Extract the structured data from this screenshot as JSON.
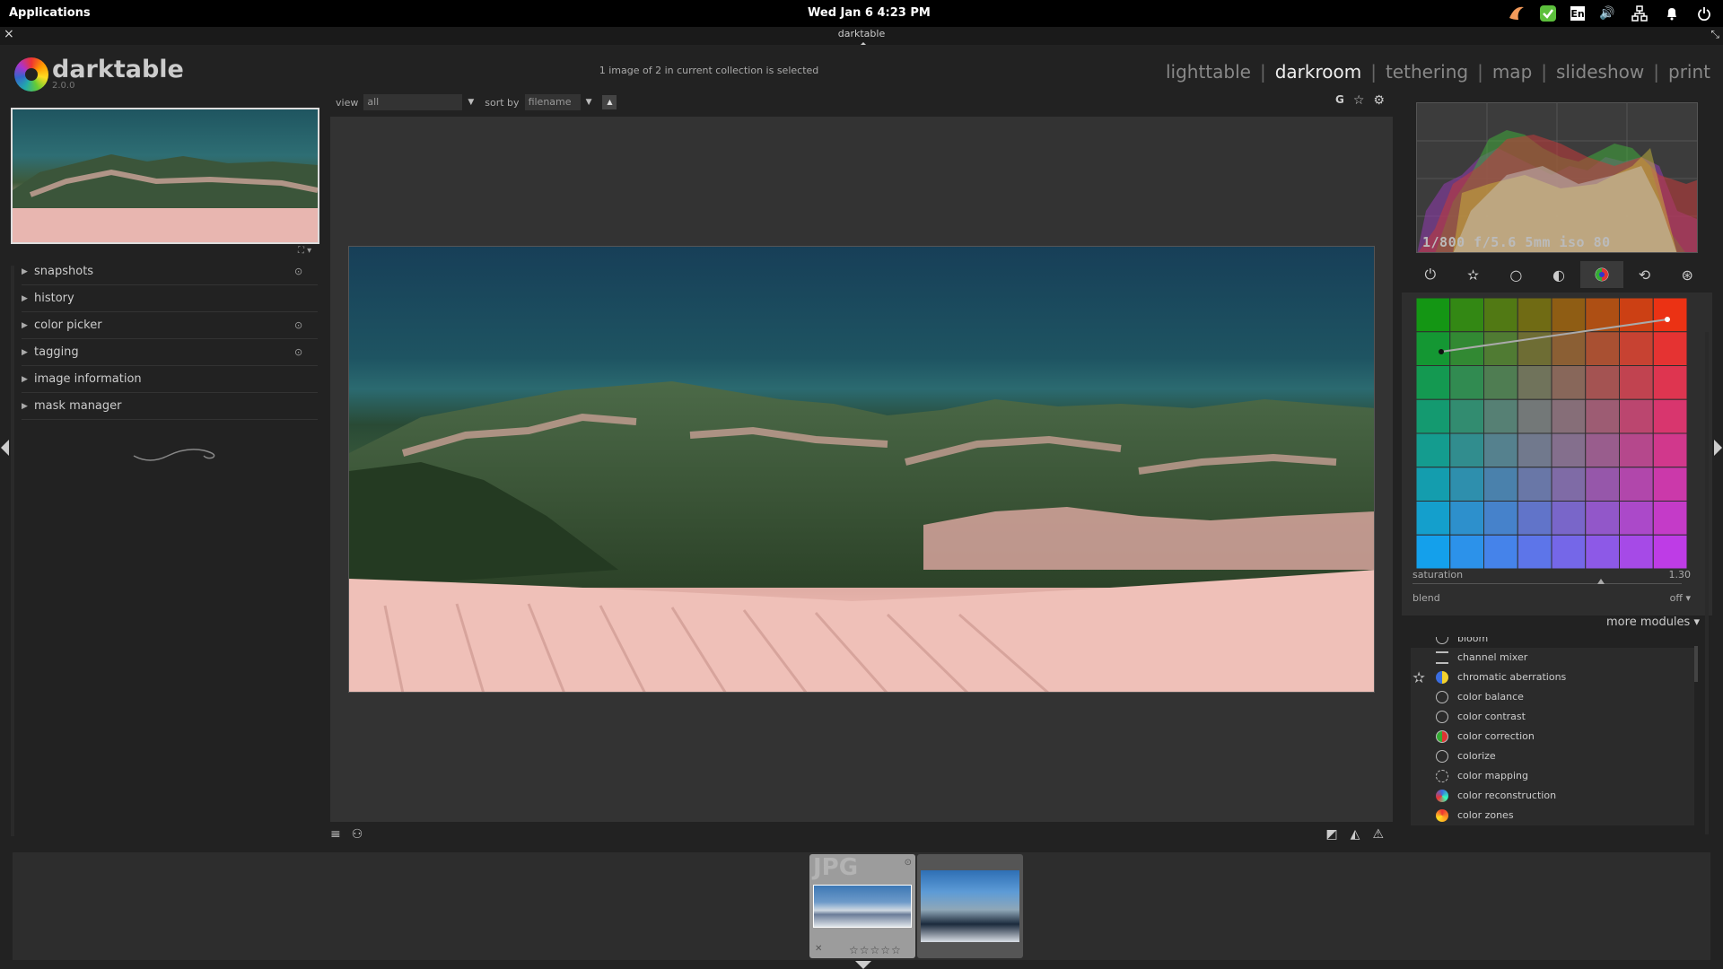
{
  "system_bar": {
    "applications": "Applications",
    "clock": "Wed Jan  6    4:23 PM",
    "tray_icons": [
      "night-light-icon",
      "shield-check-icon",
      "keyboard-layout-icon",
      "volume-icon",
      "network-icon",
      "notification-bell-icon",
      "power-icon"
    ],
    "keyboard_layout": "En"
  },
  "window": {
    "title": "darktable"
  },
  "app": {
    "name": "darktable",
    "version": "2.0.0"
  },
  "header": {
    "collection_info": "1 image of 2 in current collection is selected",
    "views": [
      "lighttable",
      "darkroom",
      "tethering",
      "map",
      "slideshow",
      "print"
    ],
    "active_view": "darkroom",
    "separator": "|"
  },
  "filter_bar": {
    "view_label": "view",
    "view_value": "all",
    "sort_label": "sort by",
    "sort_value": "filename"
  },
  "top_right_icons": {
    "grouping": "G"
  },
  "left_modules": [
    {
      "label": "snapshots",
      "pin": true
    },
    {
      "label": "history",
      "pin": false
    },
    {
      "label": "color picker",
      "pin": true
    },
    {
      "label": "tagging",
      "pin": true
    },
    {
      "label": "image information",
      "pin": false
    },
    {
      "label": "mask manager",
      "pin": false
    }
  ],
  "histogram": {
    "exif": "1/800 f/5.6 5mm iso 80"
  },
  "module_groups": [
    "power-icon",
    "favorite-star-icon",
    "basic-circle-icon",
    "tone-half-circle-icon",
    "color-icon",
    "correct-icon",
    "effect-icon"
  ],
  "color_correction": {
    "saturation_label": "saturation",
    "saturation_value": "1.30",
    "blend_label": "blend",
    "blend_value": "off"
  },
  "more_modules": {
    "label": "more modules"
  },
  "module_list": [
    {
      "label": "bloom",
      "icon": "bloom-icon"
    },
    {
      "label": "channel mixer",
      "icon": "channel-mixer-icon"
    },
    {
      "label": "chromatic aberrations",
      "icon": "chromatic-aberrations-icon",
      "favorite": true
    },
    {
      "label": "color balance",
      "icon": "color-balance-icon"
    },
    {
      "label": "color contrast",
      "icon": "color-contrast-icon"
    },
    {
      "label": "color correction",
      "icon": "color-correction-icon"
    },
    {
      "label": "colorize",
      "icon": "colorize-icon"
    },
    {
      "label": "color mapping",
      "icon": "color-mapping-icon"
    },
    {
      "label": "color reconstruction",
      "icon": "color-reconstruction-icon"
    },
    {
      "label": "color zones",
      "icon": "color-zones-icon"
    }
  ],
  "filmstrip": {
    "thumb1_label": "JPG",
    "thumb1_stars": "☆☆☆☆☆"
  }
}
